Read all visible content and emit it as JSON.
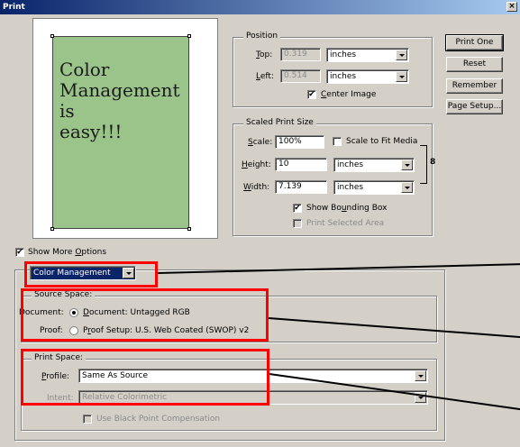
{
  "window": {
    "title": "Print",
    "close_glyph": "×"
  },
  "preview": {
    "paper_text": [
      "Color",
      "Management",
      "is",
      "easy!!!"
    ]
  },
  "position": {
    "title": "Position",
    "top_label": "Top:",
    "top_value": "0.319",
    "top_unit": "inches",
    "left_label": "Left:",
    "left_value": "0.514",
    "left_unit": "inches",
    "center_image_label": "Center Image",
    "center_image_checked": "✔"
  },
  "scaled": {
    "title": "Scaled Print Size",
    "scale_label": "Scale:",
    "scale_value": "100%",
    "fit_label": "Scale to Fit Media",
    "height_label": "Height:",
    "height_value": "10",
    "height_unit": "inches",
    "width_label": "Width:",
    "width_value": "7.139",
    "width_unit": "inches",
    "link_glyph": "8",
    "bbox_label": "Show Bounding Box",
    "bbox_checked": "✔",
    "selected_label": "Print Selected Area"
  },
  "buttons": {
    "print_one": "Print One",
    "reset": "Reset",
    "remember": "Remember",
    "page_setup": "Page Setup..."
  },
  "more_options": {
    "label": "Show More Options",
    "checked": "✔"
  },
  "mode_select": {
    "value": "Color Management"
  },
  "source": {
    "title": "Source Space:",
    "document_label": "Document:",
    "document_option": "Document:",
    "document_value": "Untagged RGB",
    "proof_label": "Proof:",
    "proof_option": "Proof Setup:",
    "proof_value": "U.S. Web Coated (SWOP) v2"
  },
  "print_space": {
    "title": "Print Space:",
    "profile_label": "Profile:",
    "profile_value": "Same As Source",
    "intent_label": "Intent:",
    "intent_value": "Relative Colorimetric",
    "bpc_label": "Use Black Point Compensation"
  },
  "colors": {
    "highlight": "#ff0000",
    "paper": "#9bc48b",
    "dialog": "#d4d0c8",
    "title_bar": "#0a246a"
  }
}
